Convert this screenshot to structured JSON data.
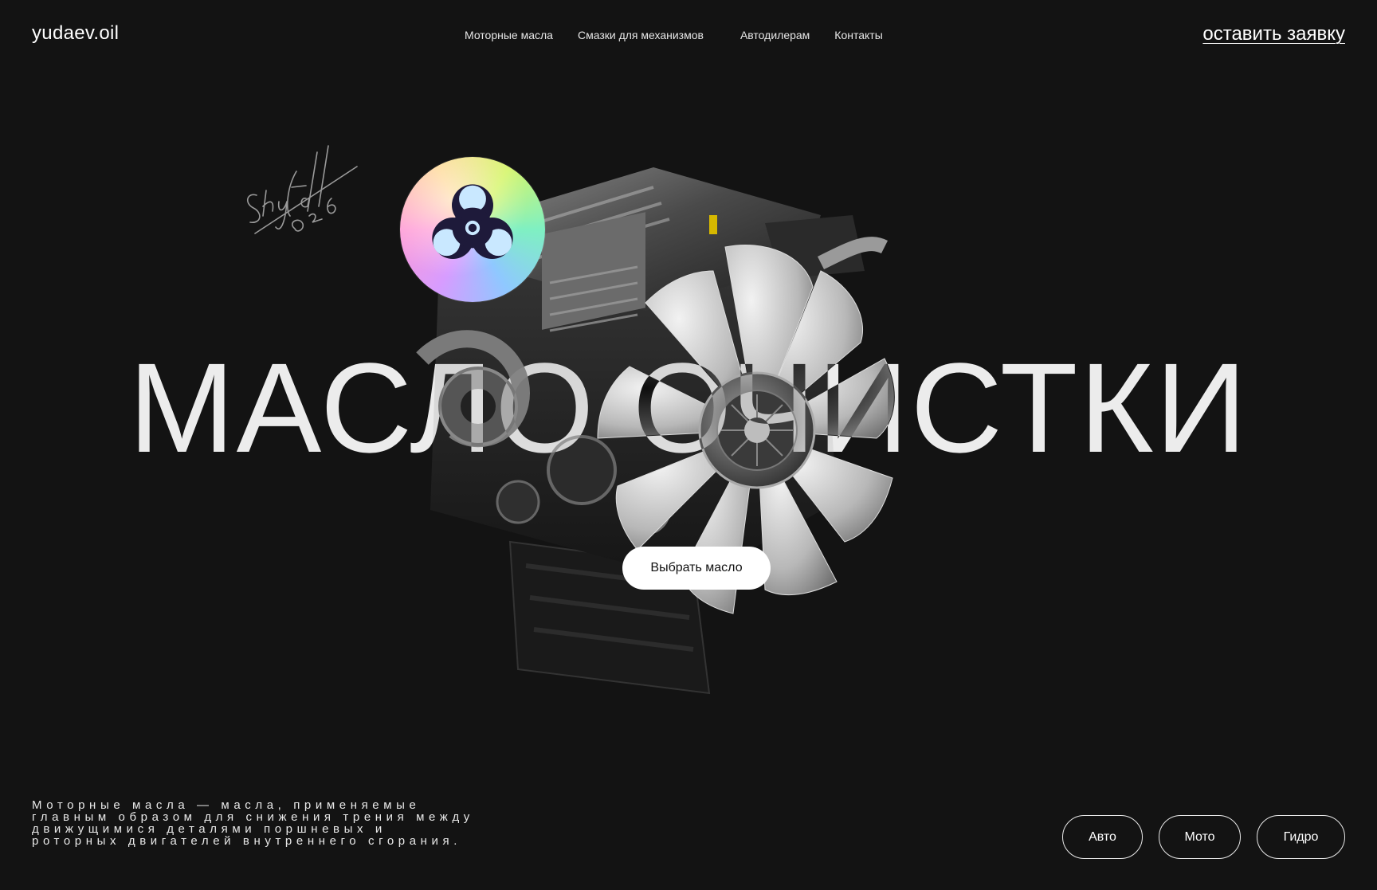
{
  "header": {
    "logo": "yudaev.oil",
    "nav": [
      "Моторные масла",
      "Смазки для механизмов",
      "Автодилерам",
      "Контакты"
    ],
    "cta": "оставить заявку"
  },
  "hero": {
    "title": "МАСЛО ОЧИСТКИ",
    "button": "Выбрать масло",
    "signature": "Skyfall 026",
    "sticker_icon": "biohazard-icon"
  },
  "description": "Моторные масла — масла, применяемые главным образом для снижения трения между движущимися деталями поршневых и роторных двигателей внутреннего сгорания.",
  "categories": [
    "Авто",
    "Мото",
    "Гидро"
  ],
  "colors": {
    "background": "#131313",
    "text": "#ffffff",
    "button_bg": "#ffffff",
    "button_text": "#111111"
  }
}
